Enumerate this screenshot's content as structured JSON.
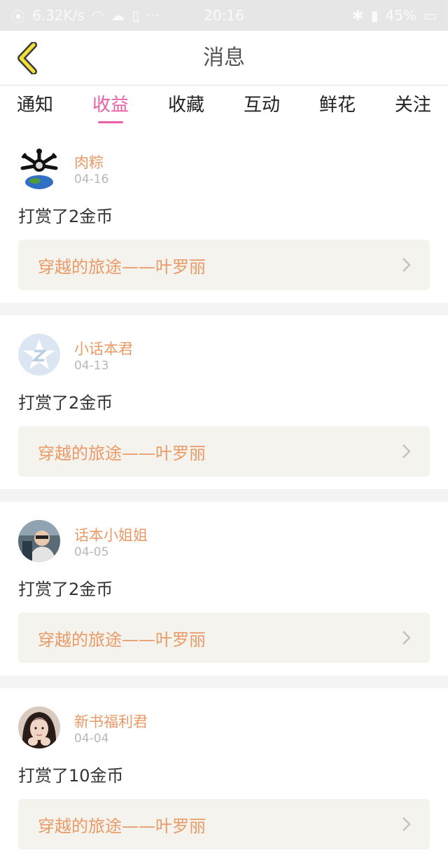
{
  "status_bar": {
    "speed": "6.32K/s",
    "time": "20:16",
    "battery": "45%"
  },
  "header": {
    "title": "消息"
  },
  "tabs": [
    {
      "label": "通知",
      "active": false
    },
    {
      "label": "收益",
      "active": true
    },
    {
      "label": "收藏",
      "active": false
    },
    {
      "label": "互动",
      "active": false
    },
    {
      "label": "鲜花",
      "active": false
    },
    {
      "label": "关注",
      "active": false
    }
  ],
  "items": [
    {
      "user": "肉粽",
      "date": "04-16",
      "action": "打赏了2金币",
      "book": "穿越的旅途——叶罗丽",
      "avatar": "globe-logo"
    },
    {
      "user": "小话本君",
      "date": "04-13",
      "action": "打赏了2金币",
      "book": "穿越的旅途——叶罗丽",
      "avatar": "star-z-logo"
    },
    {
      "user": "话本小姐姐",
      "date": "04-05",
      "action": "打赏了2金币",
      "book": "穿越的旅途——叶罗丽",
      "avatar": "photo-person"
    },
    {
      "user": "新书福利君",
      "date": "04-04",
      "action": "打赏了10金币",
      "book": "穿越的旅途——叶罗丽",
      "avatar": "photo-girl"
    }
  ],
  "colors": {
    "accent": "#e85fa5",
    "name_orange": "#e99a67",
    "back_icon_yellow": "#f2df3a"
  }
}
